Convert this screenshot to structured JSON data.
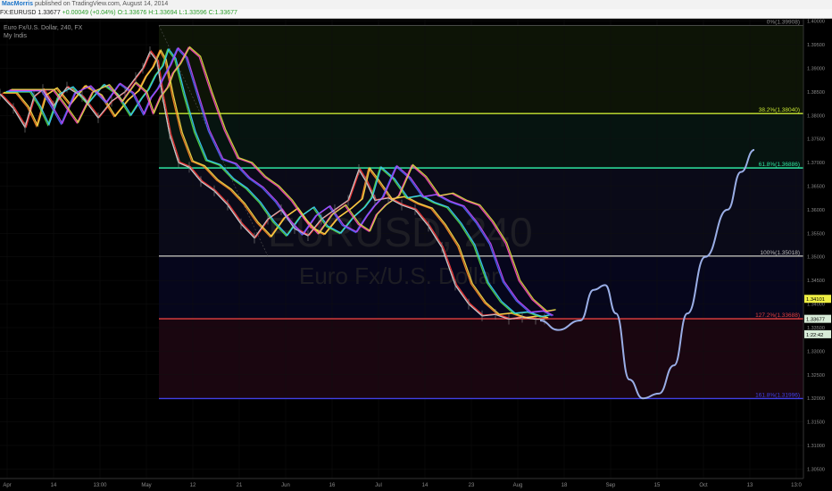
{
  "header": {
    "author": "MacMorris",
    "published": "published on TradingView.com, August 14, 2014"
  },
  "symbol_bar": {
    "symbol": "FX:EURUSD",
    "last": "1.33677",
    "change": "+0.00049 (+0.04%)",
    "open": "O:1.33676",
    "high": "H:1.33694",
    "low": "L:1.33596",
    "close": "C:1.33677"
  },
  "legend": {
    "line1": "Euro Fx/U.S. Dollar, 240, FX",
    "line2": "My Indis"
  },
  "watermark": {
    "symbol": "EURUSD, 240",
    "name": "Euro Fx/U.S. Dollar"
  },
  "chart_data": {
    "type": "line",
    "x_ticks": [
      "Apr",
      "14",
      "13:00",
      "May",
      "12",
      "21",
      "Jun",
      "16",
      "Jul",
      "14",
      "23",
      "Aug",
      "18",
      "Sep",
      "15",
      "Oct",
      "13",
      "13:0"
    ],
    "ylim": [
      1.303,
      1.4005
    ],
    "y_ticks": [
      "1.40000",
      "1.39500",
      "1.39000",
      "1.38500",
      "1.38000",
      "1.37500",
      "1.37000",
      "1.36500",
      "1.36000",
      "1.35500",
      "1.35000",
      "1.34500",
      "1.34000",
      "1.33500",
      "1.33000",
      "1.32500",
      "1.32000",
      "1.31500",
      "1.31000",
      "1.30500"
    ],
    "fib_levels": [
      {
        "label": "0%(1.39908)",
        "value": 1.39908,
        "color": "#888888"
      },
      {
        "label": "38.2%(1.38040)",
        "value": 1.3804,
        "color": "#c8e632"
      },
      {
        "label": "61.8%(1.36886)",
        "value": 1.36886,
        "color": "#2ee6a0"
      },
      {
        "label": "100%(1.35018)",
        "value": 1.35018,
        "color": "#b8b8b8"
      },
      {
        "label": "127.2%(1.33688)",
        "value": 1.33688,
        "color": "#e64040"
      },
      {
        "label": "161.8%(1.31996)",
        "value": 1.31996,
        "color": "#4040e6"
      }
    ],
    "price_labels": [
      {
        "label": "1.34101",
        "value": 1.34101,
        "bg": "#eeee44",
        "fg": "#000000"
      },
      {
        "label": "1.33677",
        "value": 1.33677,
        "bg": "#d8ecd8",
        "fg": "#000000"
      },
      {
        "label": "1:22:42",
        "value": 1.3335,
        "bg": "#d8ecd8",
        "fg": "#000000"
      }
    ],
    "price_series": {
      "x": [
        0,
        15,
        28,
        38,
        48,
        60,
        75,
        92,
        110,
        125,
        140,
        152,
        160,
        168,
        176,
        182,
        190,
        200,
        212,
        225,
        240,
        255,
        270,
        285,
        300,
        315,
        330,
        345,
        360,
        375,
        390,
        402,
        410,
        420,
        435,
        450,
        465,
        480,
        495,
        510,
        525,
        540,
        555,
        570,
        585,
        600,
        610
      ],
      "y": [
        1.3845,
        1.3815,
        1.3775,
        1.384,
        1.3855,
        1.382,
        1.386,
        1.384,
        1.3795,
        1.383,
        1.385,
        1.388,
        1.39,
        1.3935,
        1.3915,
        1.384,
        1.376,
        1.37,
        1.369,
        1.366,
        1.364,
        1.361,
        1.357,
        1.354,
        1.358,
        1.36,
        1.356,
        1.3545,
        1.358,
        1.36,
        1.362,
        1.3685,
        1.366,
        1.362,
        1.3625,
        1.361,
        1.36,
        1.3565,
        1.352,
        1.344,
        1.34,
        1.3375,
        1.3378,
        1.3368,
        1.3372,
        1.3368,
        1.3368
      ]
    },
    "projection": {
      "x": [
        605,
        625,
        650,
        665,
        678,
        690,
        705,
        720,
        738,
        755,
        770,
        790,
        815,
        830,
        845
      ],
      "y": [
        1.3365,
        1.3345,
        1.3365,
        1.343,
        1.344,
        1.338,
        1.324,
        1.32,
        1.321,
        1.327,
        1.338,
        1.35,
        1.36,
        1.368,
        1.3727
      ]
    },
    "ribbon_colors": [
      "#ffffff",
      "#ff3a3a",
      "#ff8a2a",
      "#ffe24a",
      "#5ae04a",
      "#3ad0ff",
      "#4a6aff",
      "#c04aff",
      "#ff4ac0",
      "#e0e040"
    ]
  }
}
